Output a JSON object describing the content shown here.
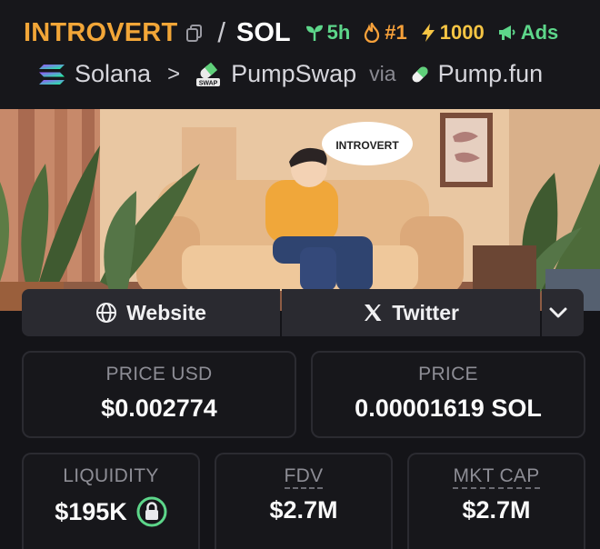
{
  "header": {
    "token_name": "INTROVERT",
    "slash": "/",
    "quote_token": "SOL",
    "badges": {
      "age": "5h",
      "rank": "#1",
      "boost": "1000",
      "ads": "Ads"
    },
    "chain": "Solana",
    "dex": "PumpSwap",
    "via": "via",
    "launchpad": "Pump.fun"
  },
  "banner": {
    "speech_bubble": "INTROVERT"
  },
  "links": {
    "website": "Website",
    "twitter": "Twitter"
  },
  "stats": {
    "price_usd_label": "PRICE USD",
    "price_usd_value": "$0.002774",
    "price_label": "PRICE",
    "price_value": "0.00001619 SOL",
    "liquidity_label": "LIQUIDITY",
    "liquidity_value": "$195K",
    "fdv_label": "FDV",
    "fdv_value": "$2.7M",
    "mktcap_label": "MKT CAP",
    "mktcap_value": "$2.7M"
  },
  "colors": {
    "accent_orange": "#f2a638",
    "accent_green": "#5dd68a",
    "accent_yellow": "#f6c544",
    "background": "#141418",
    "card_border": "#2b2b31"
  }
}
